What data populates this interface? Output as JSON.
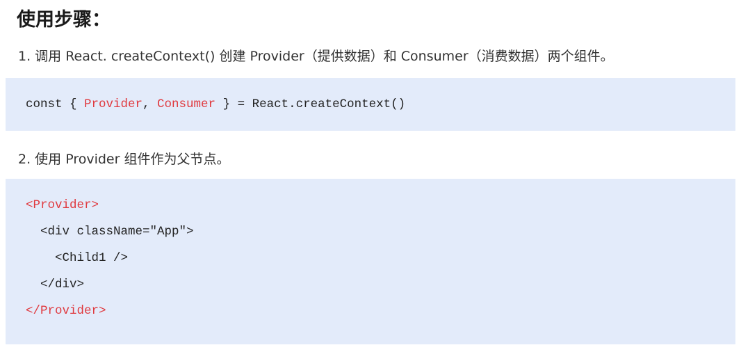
{
  "heading": "使用步骤：",
  "steps": [
    {
      "text": "1. 调用 React. createContext() 创建 Provider（提供数据）和 Consumer（消费数据）两个组件。",
      "code": {
        "prefix": "const { ",
        "provider": "Provider",
        "comma": ", ",
        "consumer": "Consumer",
        "suffix": " } = React.createContext()"
      }
    },
    {
      "text": "2. 使用 Provider 组件作为父节点。",
      "code_lines": [
        "<Provider>",
        "  <div className=\"App\">",
        "    <Child1 />",
        "  </div>",
        "</Provider>"
      ]
    }
  ],
  "colors": {
    "code_background": "#e3ebfa",
    "highlight": "#e0393e"
  }
}
